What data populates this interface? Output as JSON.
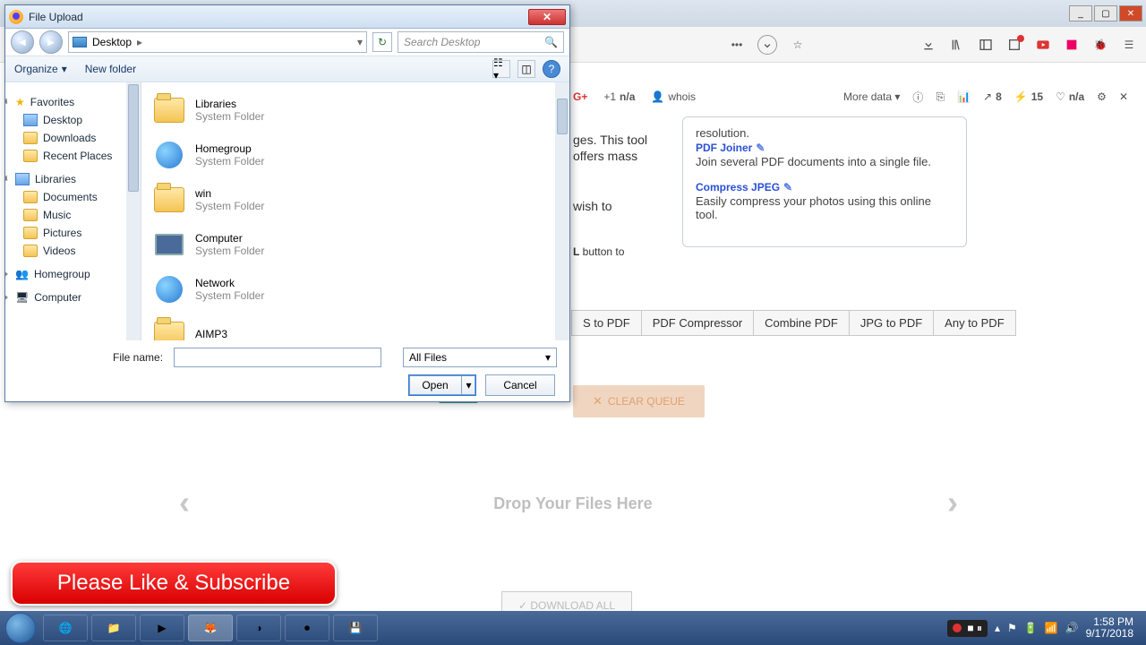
{
  "dialog": {
    "title": "File Upload",
    "location": "Desktop",
    "search_placeholder": "Search Desktop",
    "organize": "Organize",
    "new_folder": "New folder",
    "file_name_label": "File name:",
    "file_name_value": "",
    "filter": "All Files",
    "open": "Open",
    "cancel": "Cancel",
    "nav": {
      "favorites": "Favorites",
      "desktop": "Desktop",
      "downloads": "Downloads",
      "recent": "Recent Places",
      "libraries": "Libraries",
      "documents": "Documents",
      "music": "Music",
      "pictures": "Pictures",
      "videos": "Videos",
      "homegroup": "Homegroup",
      "computer": "Computer"
    },
    "items": [
      {
        "name": "Libraries",
        "sub": "System Folder"
      },
      {
        "name": "Homegroup",
        "sub": "System Folder"
      },
      {
        "name": "win",
        "sub": "System Folder"
      },
      {
        "name": "Computer",
        "sub": "System Folder"
      },
      {
        "name": "Network",
        "sub": "System Folder"
      },
      {
        "name": "AIMP3",
        "sub": ""
      }
    ]
  },
  "infobar": {
    "plusone": "+1",
    "na1": "n/a",
    "whois": "whois",
    "more": "More data",
    "stat1": "8",
    "stat2": "15",
    "stat3": "n/a"
  },
  "sidebox": {
    "line0": "resolution.",
    "h1": "PDF Joiner",
    "d1": "Join several PDF documents into a single file.",
    "h2": "Compress JPEG",
    "d2": "Easily compress your photos using this online tool."
  },
  "frags": {
    "a": "ges. This tool",
    "b": "offers mass",
    "c": "wish to",
    "d": " button to",
    "dstrong": "L"
  },
  "tabs": [
    "S to PDF",
    "PDF Compressor",
    "Combine PDF",
    "JPG to PDF",
    "Any to PDF"
  ],
  "buttons": {
    "clear": "CLEAR QUEUE",
    "upload_hidden": " ",
    "drop": "Drop Your Files Here",
    "dlall": "DOWNLOAD ALL"
  },
  "subscribe": "Please Like & Subscribe",
  "tray": {
    "time": "1:58 PM",
    "date": "9/17/2018"
  },
  "browser_btns": {
    "min": "_",
    "max": "▢",
    "close": "✕"
  }
}
